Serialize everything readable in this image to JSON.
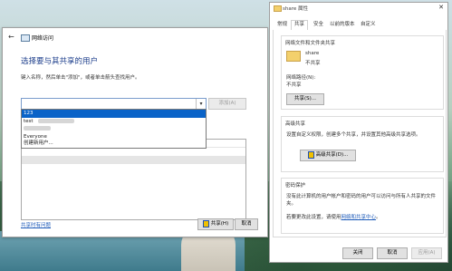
{
  "left_dialog": {
    "window_title": "网络访问",
    "heading": "选择要与其共享的用户",
    "instruction": "键入名称，然后单击\"添加\"，或者单击箭头查找用户。",
    "combo_value": "",
    "add_button": "添加(A)",
    "dropdown_items": [
      "123",
      "test",
      "Everyone",
      "创建新用户..."
    ],
    "help_link": "共享时有问题",
    "share_button": "共享(H)",
    "cancel_button": "取消"
  },
  "right_dialog": {
    "window_title": "share 属性",
    "tabs": [
      "常规",
      "共享",
      "安全",
      "以前的版本",
      "自定义"
    ],
    "active_tab": "共享",
    "share_group_title": "网络文件和文件夹共享",
    "folder_name": "share",
    "share_status": "不共享",
    "network_path_label": "网络路径(N):",
    "network_path_value": "不共享",
    "share_button": "共享(S)...",
    "advanced_group_title": "高级共享",
    "advanced_description": "设置自定义权限，创建多个共享，并设置其他高级共享选项。",
    "advanced_button": "高级共享(D)...",
    "password_group_title": "密码保护",
    "password_description_line1": "没有此计算机的用户帐户和密码的用户可以访问与所有人共享的文件",
    "password_description_line2": "夹。",
    "password_setting_text": "若要更改此设置，请使用",
    "password_link": "网络和共享中心",
    "password_link_suffix": "。",
    "ok_button": "关闭",
    "cancel_button": "取消",
    "apply_button": "应用(A)"
  }
}
